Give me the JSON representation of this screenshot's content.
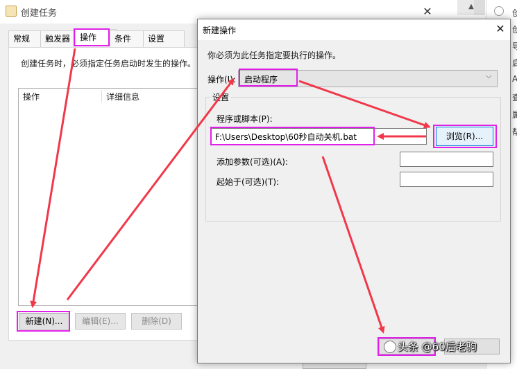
{
  "background_window": {
    "title": "创建任务",
    "close_glyph": "✕",
    "tabs": [
      "常规",
      "触发器",
      "操作",
      "条件",
      "设置"
    ],
    "active_tab": "操作",
    "description": "创建任务时，必须指定任务启动时发生的操作。",
    "list_columns": [
      "操作",
      "详细信息"
    ],
    "buttons": {
      "new": "新建(N)...",
      "edit": "编辑(E)...",
      "delete": "删除(D)"
    }
  },
  "right_strip": {
    "chars": [
      "创",
      "创",
      "导",
      "启",
      "A",
      "查",
      "属",
      "帮"
    ]
  },
  "dialog": {
    "title": "新建操作",
    "close_glyph": "✕",
    "instruction": "你必须为此任务指定要执行的操作。",
    "operation_label": "操作(I):",
    "operation_value": "启动程序",
    "settings_legend": "设置",
    "program_label": "程序或脚本(P):",
    "program_value": "F:\\Users\\Desktop\\60秒自动关机.bat",
    "browse_label": "浏览(R)...",
    "args_label": "添加参数(可选)(A):",
    "args_value": "",
    "start_label": "起始于(可选)(T):",
    "start_value": ""
  },
  "watermark": "头条 @60后老驹",
  "colors": {
    "highlight": "#e020e8",
    "arrow": "#f0384a",
    "focus_blue": "#0078d7"
  }
}
